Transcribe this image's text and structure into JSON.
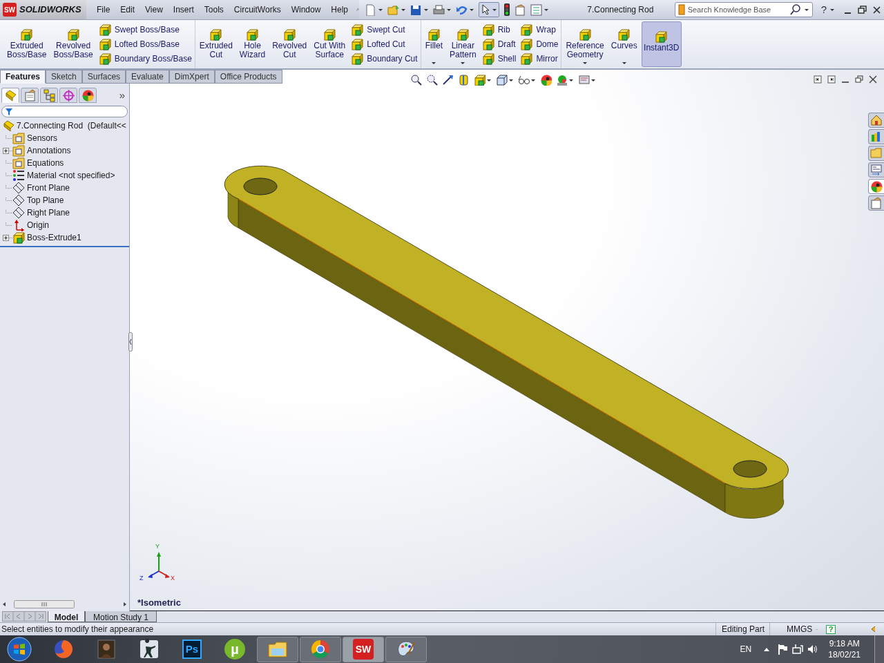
{
  "app": {
    "badge": "SW",
    "logo": "SOLIDWORKS"
  },
  "menu": [
    "File",
    "Edit",
    "View",
    "Insert",
    "Tools",
    "CircuitWorks",
    "Window",
    "Help"
  ],
  "document_title": "7.Connecting Rod",
  "search": {
    "placeholder": "Search Knowledge Base"
  },
  "help_glyph": "?",
  "command_groups": [
    {
      "items": [
        {
          "kind": "big",
          "lines": [
            "Extruded",
            "Boss/Base"
          ],
          "dropdown": false,
          "on": false
        },
        {
          "kind": "big",
          "lines": [
            "Revolved",
            "Boss/Base"
          ],
          "dropdown": false,
          "on": false
        },
        {
          "kind": "stack",
          "labels": [
            "Swept Boss/Base",
            "Lofted Boss/Base",
            "Boundary Boss/Base"
          ]
        }
      ]
    },
    {
      "items": [
        {
          "kind": "big",
          "lines": [
            "Extruded",
            "Cut"
          ],
          "dropdown": false,
          "on": false
        },
        {
          "kind": "big",
          "lines": [
            "Hole",
            "Wizard"
          ],
          "dropdown": false,
          "on": false
        },
        {
          "kind": "big",
          "lines": [
            "Revolved",
            "Cut"
          ],
          "dropdown": false,
          "on": false
        },
        {
          "kind": "big",
          "lines": [
            "Cut With",
            "Surface"
          ],
          "dropdown": false,
          "on": false
        },
        {
          "kind": "stack",
          "labels": [
            "Swept Cut",
            "Lofted Cut",
            "Boundary Cut"
          ]
        }
      ]
    },
    {
      "items": [
        {
          "kind": "big",
          "lines": [
            "Fillet"
          ],
          "dropdown": true,
          "on": false
        },
        {
          "kind": "big",
          "lines": [
            "Linear",
            "Pattern"
          ],
          "dropdown": true,
          "on": false
        },
        {
          "kind": "stack",
          "labels": [
            "Rib",
            "Draft",
            "Shell"
          ]
        },
        {
          "kind": "stack",
          "labels": [
            "Wrap",
            "Dome",
            "Mirror"
          ]
        }
      ]
    },
    {
      "items": [
        {
          "kind": "big",
          "lines": [
            "Reference",
            "Geometry"
          ],
          "dropdown": true,
          "on": false
        },
        {
          "kind": "big",
          "lines": [
            "Curves"
          ],
          "dropdown": true,
          "on": false
        },
        {
          "kind": "big",
          "lines": [
            "Instant3D"
          ],
          "dropdown": false,
          "on": true
        }
      ]
    }
  ],
  "command_tabs": [
    {
      "label": "Features",
      "selected": true
    },
    {
      "label": "Sketch",
      "selected": false
    },
    {
      "label": "Surfaces",
      "selected": false
    },
    {
      "label": "Evaluate",
      "selected": false
    },
    {
      "label": "DimXpert",
      "selected": false
    },
    {
      "label": "Office Products",
      "selected": false
    }
  ],
  "feature_manager": {
    "tabs": [
      {
        "selected": true
      },
      {
        "selected": false
      },
      {
        "selected": false
      },
      {
        "selected": false
      },
      {
        "selected": false
      }
    ],
    "more_glyph": "»",
    "tree": {
      "label": "7.Connecting Rod  (Default<<",
      "kind": "part",
      "children": [
        {
          "label": "Sensors",
          "kind": "folder"
        },
        {
          "label": "Annotations",
          "kind": "folder",
          "expanded": false
        },
        {
          "label": "Equations",
          "kind": "folder"
        },
        {
          "label": "Material <not specified>",
          "kind": "material"
        },
        {
          "label": "Front Plane",
          "kind": "plane"
        },
        {
          "label": "Top Plane",
          "kind": "plane"
        },
        {
          "label": "Right Plane",
          "kind": "plane"
        },
        {
          "label": "Origin",
          "kind": "origin"
        },
        {
          "label": "Boss-Extrude1",
          "kind": "feature",
          "expanded": false
        }
      ]
    }
  },
  "viewport": {
    "view_label": "*Isometric",
    "triad": {
      "x_label": "X",
      "y_label": "Y",
      "z_label": "Z"
    },
    "task_pane": [
      {
        "selected": false
      },
      {
        "selected": false
      },
      {
        "selected": false
      },
      {
        "selected": false
      },
      {
        "selected": true
      },
      {
        "selected": false
      }
    ]
  },
  "model_tabs": [
    {
      "label": "Model",
      "selected": true
    },
    {
      "label": "Motion Study 1",
      "selected": false
    }
  ],
  "status_bar": {
    "message": "Select entities to modify their appearance",
    "mode": "Editing Part",
    "units": "MMGS",
    "help_glyph": "?"
  },
  "taskbar": {
    "apps": [
      {
        "running": false,
        "selected": false
      },
      {
        "running": false,
        "selected": false
      },
      {
        "running": false,
        "selected": false
      },
      {
        "running": false,
        "selected": false,
        "glyph": "Ps"
      },
      {
        "running": false,
        "selected": false,
        "glyph": "µ"
      },
      {
        "running": true,
        "selected": false
      },
      {
        "running": true,
        "selected": false
      },
      {
        "running": true,
        "selected": true,
        "glyph": "SW"
      },
      {
        "running": true,
        "selected": false
      }
    ],
    "language": "EN",
    "time": "9:18 AM",
    "date": "18/02/21"
  }
}
